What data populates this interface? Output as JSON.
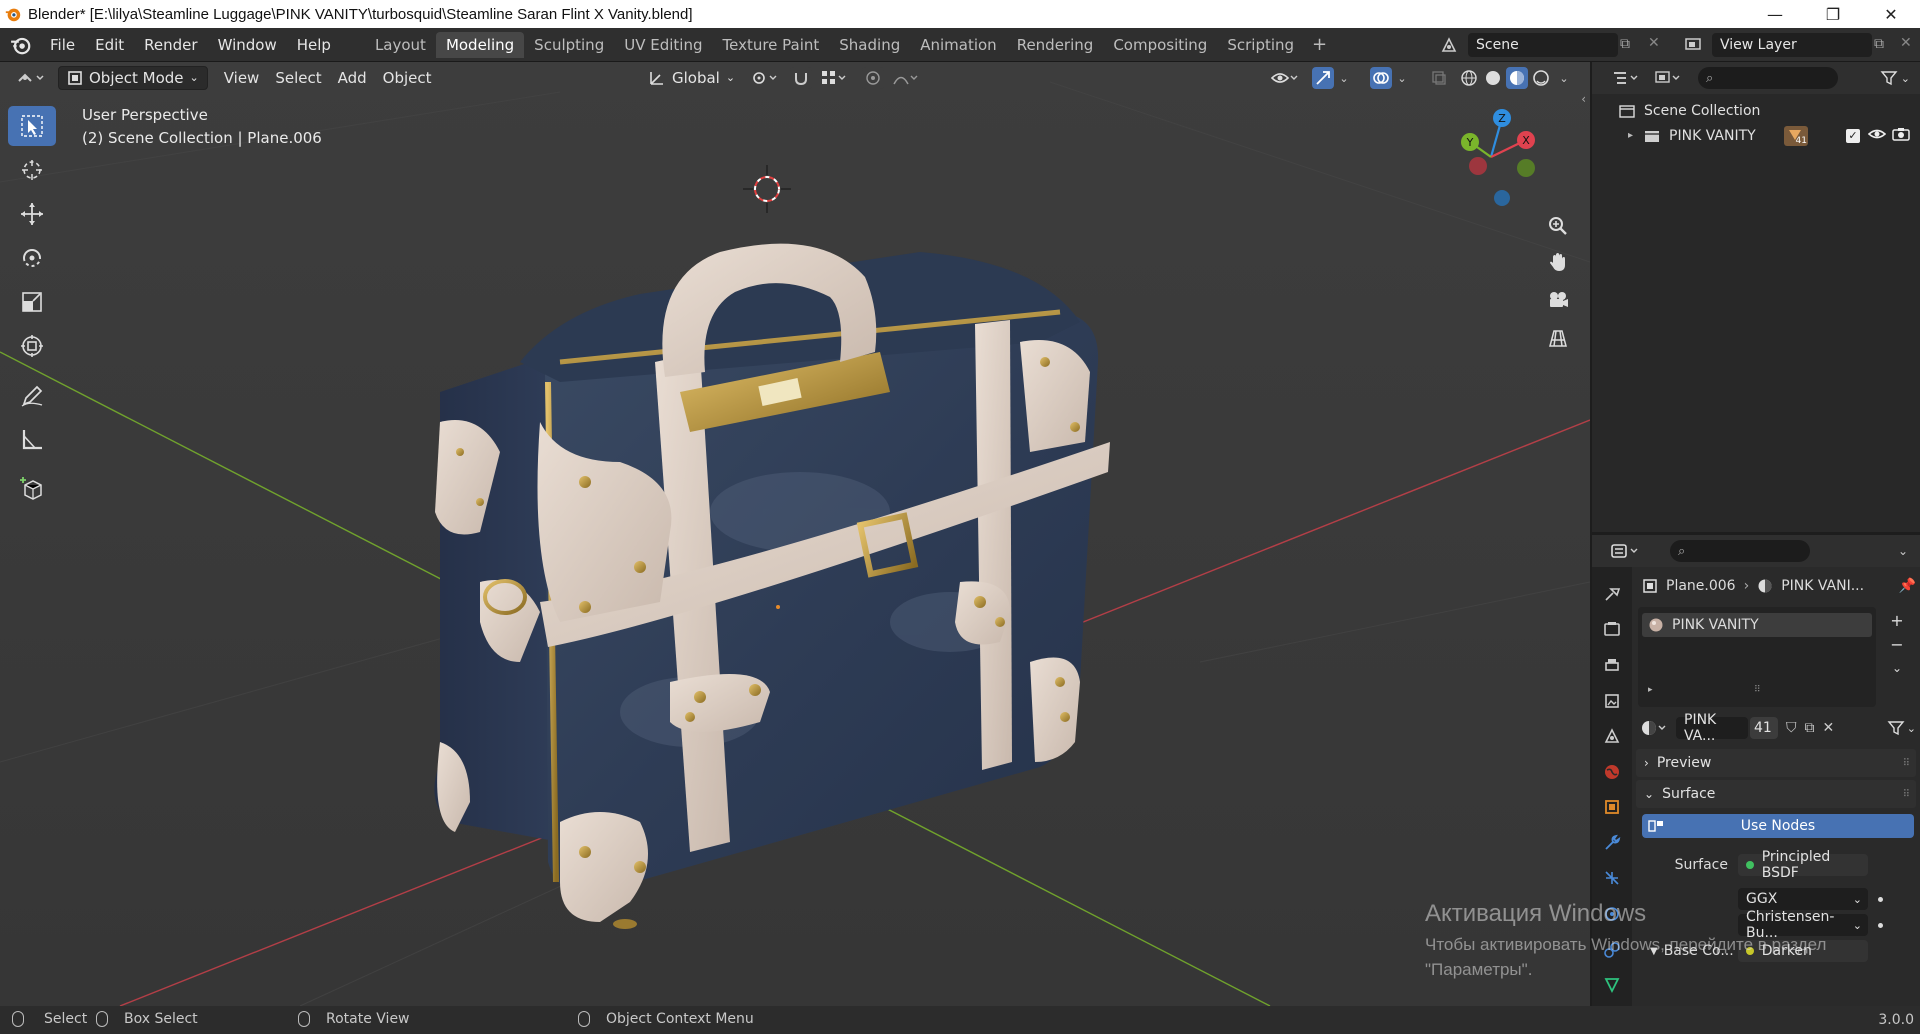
{
  "window": {
    "title": "Blender* [E:\\lilya\\Steamline Luggage\\PINK VANITY\\turbosquid\\Steamline Saran Flint X Vanity.blend]",
    "minimize": "—",
    "maximize": "❐",
    "close": "✕"
  },
  "menu": {
    "items": [
      "File",
      "Edit",
      "Render",
      "Window",
      "Help"
    ]
  },
  "workspaces": {
    "tabs": [
      "Layout",
      "Modeling",
      "Sculpting",
      "UV Editing",
      "Texture Paint",
      "Shading",
      "Animation",
      "Rendering",
      "Compositing",
      "Scripting"
    ],
    "active": "Modeling",
    "add": "+"
  },
  "scene": {
    "name": "Scene"
  },
  "view_layer": {
    "name": "View Layer"
  },
  "viewport_header": {
    "mode": "Object Mode",
    "menus": [
      "View",
      "Select",
      "Add",
      "Object"
    ],
    "transform_orientation": "Global"
  },
  "viewport": {
    "perspective": "User Perspective",
    "context": "(2) Scene Collection | Plane.006",
    "gizmo": {
      "x": "X",
      "y": "Y",
      "z": "Z"
    }
  },
  "watermark": {
    "title": "Активация Windows",
    "line1": "Чтобы активировать Windows, перейдите в раздел",
    "line2": "\"Параметры\"."
  },
  "outliner": {
    "root": "Scene Collection",
    "items": [
      {
        "name": "PINK VANITY",
        "badge": "41"
      }
    ]
  },
  "properties": {
    "breadcrumb": {
      "object": "Plane.006",
      "material": "PINK VANI..."
    },
    "material_slot": "PINK VANITY",
    "material_name": "PINK VA...",
    "user_count": "41",
    "panels": {
      "preview": "Preview",
      "surface": "Surface"
    },
    "use_nodes": "Use Nodes",
    "surface_label": "Surface",
    "surface_value": "Principled BSDF",
    "distribution": "GGX",
    "subsurface_method": "Christensen-Bu...",
    "base_color_label": "Base Co...",
    "base_color_value": "Darken"
  },
  "statusbar": {
    "select": "Select",
    "box_select": "Box Select",
    "rotate_view": "Rotate View",
    "context_menu": "Object Context Menu",
    "version": "3.0.0"
  },
  "colors": {
    "accent": "#4772b3",
    "x_axis": "#e0424f",
    "y_axis": "#7ab52b",
    "z_axis": "#2f8ee0"
  }
}
